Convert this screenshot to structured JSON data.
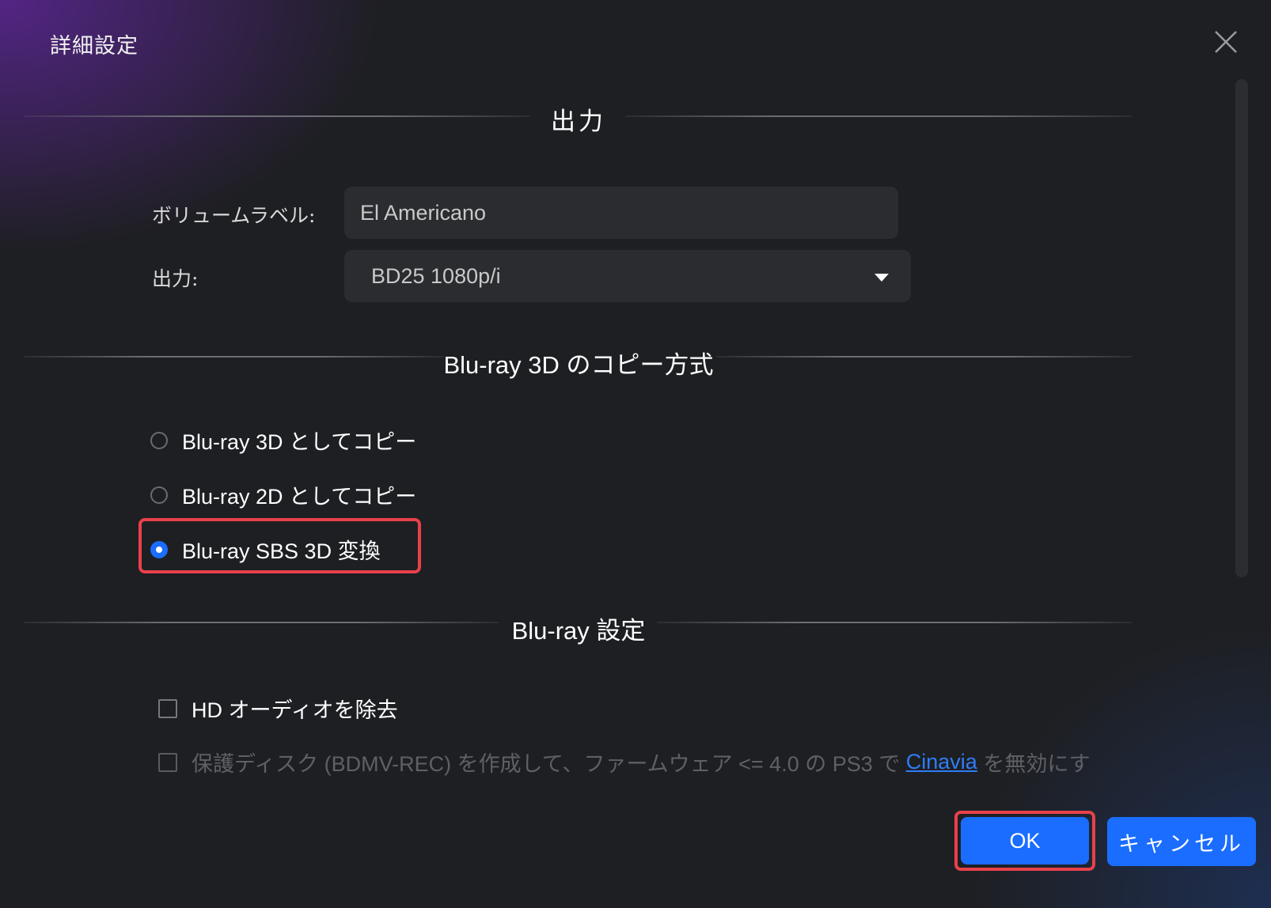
{
  "dialog": {
    "title": "詳細設定"
  },
  "sections": {
    "output_title": "出力",
    "copy_mode_title": "Blu-ray 3D のコピー方式",
    "bluray_settings_title": "Blu-ray 設定"
  },
  "output": {
    "volume_label_label": "ボリュームラベル:",
    "volume_label_value": "El Americano",
    "output_label": "出力:",
    "output_selected": "BD25 1080p/i"
  },
  "copy_mode": {
    "options": [
      {
        "label": "Blu-ray 3D としてコピー",
        "checked": false
      },
      {
        "label": "Blu-ray 2D としてコピー",
        "checked": false
      },
      {
        "label": "Blu-ray SBS 3D 変換",
        "checked": true
      }
    ],
    "highlighted_option": "Blu-ray SBS 3D 変換"
  },
  "bluray_settings": {
    "remove_hd_audio": {
      "label": "HD オーディオを除去",
      "checked": false
    },
    "protect_disc": {
      "label_before": "保護ディスク (BDMV-REC) を作成して、ファームウェア <= 4.0 の PS3 で ",
      "link_text": "Cinavia",
      "label_after": " を無効にす",
      "checked": false,
      "enabled": false
    }
  },
  "buttons": {
    "ok_label": "OK",
    "cancel_label": "キャンセル",
    "highlighted": "OK"
  },
  "colors": {
    "accent": "#1a6dff",
    "highlight_border": "#e8414b",
    "background": "#1e1f23",
    "input_bg": "#2b2c30"
  },
  "icons": {
    "close": "close-icon",
    "dropdown": "chevron-down-icon"
  }
}
